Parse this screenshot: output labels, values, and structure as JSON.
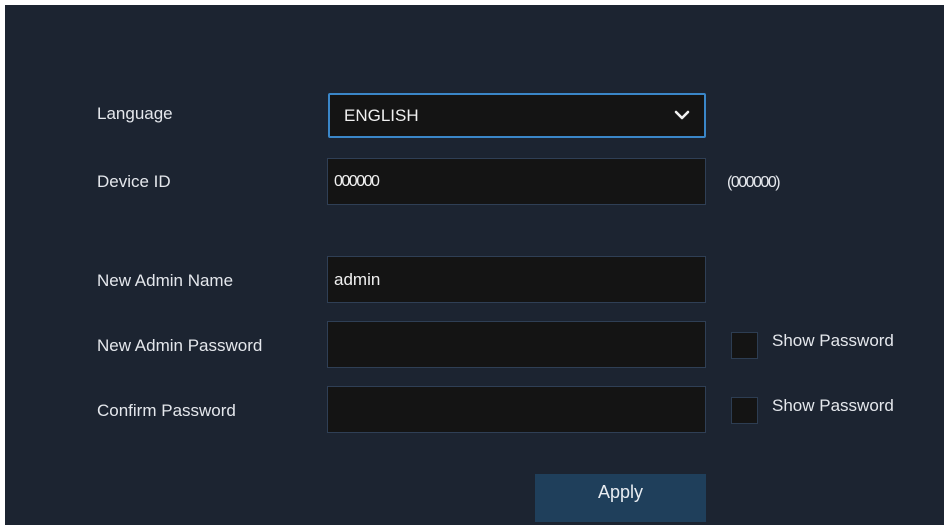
{
  "colors": {
    "panel_background": "#1c2431",
    "field_background": "#141414",
    "field_border": "#2f3f55",
    "select_border_focus": "#3a86c8",
    "apply_button": "#1f3f5b",
    "text": "#e4e7ec"
  },
  "form": {
    "language": {
      "label": "Language",
      "selected": "ENGLISH",
      "icon": "chevron-down-icon"
    },
    "device_id": {
      "label": "Device ID",
      "value": "000000",
      "hint": "(000000)"
    },
    "admin_name": {
      "label": "New Admin Name",
      "value": "admin"
    },
    "admin_password": {
      "label": "New Admin Password",
      "value": "",
      "show_password_label": "Show Password",
      "show_password_checked": false
    },
    "confirm_password": {
      "label": "Confirm Password",
      "value": "",
      "show_password_label": "Show Password",
      "show_password_checked": false
    }
  },
  "actions": {
    "apply_label": "Apply"
  }
}
